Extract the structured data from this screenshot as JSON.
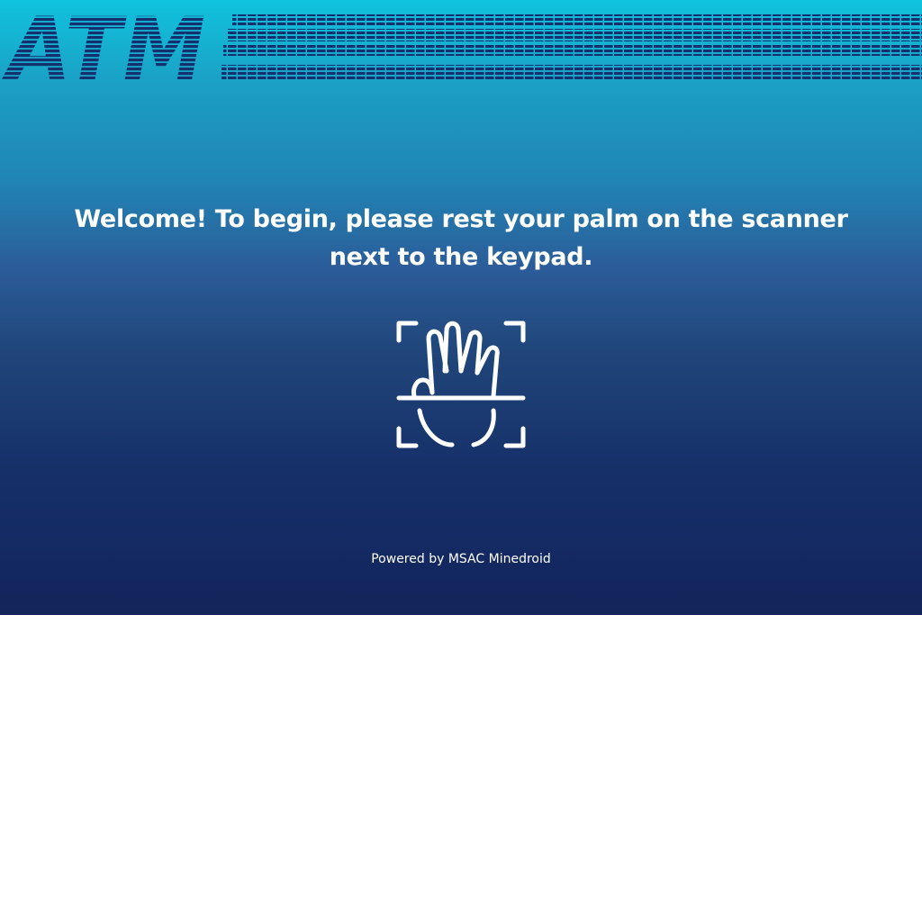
{
  "header": {
    "logo_text": "ATM",
    "logo_color": "#14306e"
  },
  "main": {
    "welcome_message": "Welcome! To begin, please rest your palm on the scanner next to the keypad.",
    "scanner_icon": "palm-scanner-icon"
  },
  "footer": {
    "powered_by": "Powered by MSAC Minedroid"
  },
  "colors": {
    "gradient_top": "#10c3de",
    "gradient_bottom": "#12255a",
    "text": "#ffffff"
  }
}
